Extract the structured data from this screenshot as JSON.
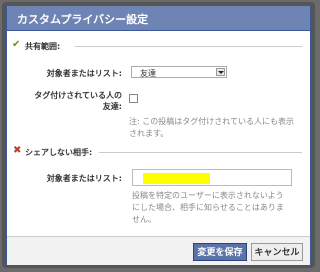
{
  "dialog": {
    "title": "カスタムプライバシー設定",
    "share_section": {
      "heading": "共有範囲:",
      "audience_label": "対象者またはリスト:",
      "audience_value": "友達",
      "tagged_label": "タグ付けされている人の友達:",
      "note": "注: この投稿はタグ付けされている人にも表示されます。"
    },
    "hide_section": {
      "heading": "シェアしない相手:",
      "audience_label": "対象者またはリスト:",
      "input_value": "",
      "note": "投稿を特定のユーザーに表示されないようにした場合、相手に知らせることはありません。"
    },
    "buttons": {
      "save": "変更を保存",
      "cancel": "キャンセル"
    }
  }
}
